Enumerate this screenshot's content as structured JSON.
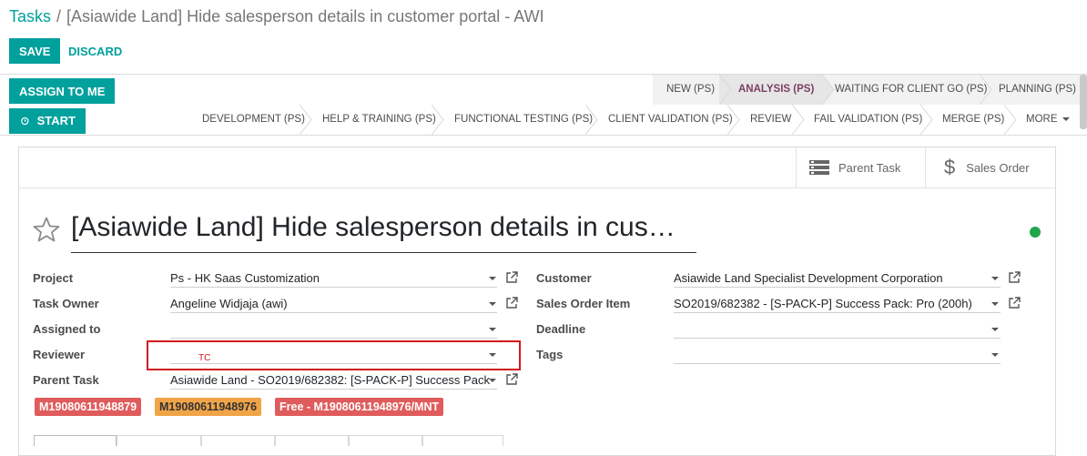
{
  "breadcrumb": {
    "root": "Tasks",
    "separator": "/",
    "current": "[Asiawide Land] Hide salesperson details in customer portal - AWI"
  },
  "controls": {
    "save": "SAVE",
    "discard": "DISCARD",
    "assign_to_me": "ASSIGN TO ME",
    "start": "START"
  },
  "stages": {
    "row1": [
      "NEW (PS)",
      "ANALYSIS (PS)",
      "WAITING FOR CLIENT GO (PS)",
      "PLANNING (PS)"
    ],
    "row2": [
      "DEVELOPMENT (PS)",
      "HELP & TRAINING (PS)",
      "FUNCTIONAL TESTING (PS)",
      "CLIENT VALIDATION (PS)",
      "REVIEW",
      "FAIL VALIDATION (PS)",
      "MERGE (PS)",
      "MORE"
    ],
    "active": "ANALYSIS (PS)"
  },
  "smart_buttons": {
    "parent_task": "Parent Task",
    "sales_order": "Sales Order"
  },
  "title": "[Asiawide Land] Hide salesperson details in cus…",
  "fields": {
    "project": {
      "label": "Project",
      "value": "Ps - HK Saas Customization"
    },
    "task_owner": {
      "label": "Task Owner",
      "value": "Angeline Widjaja (awi)"
    },
    "assigned_to": {
      "label": "Assigned to",
      "value": ""
    },
    "reviewer": {
      "label": "Reviewer",
      "value": ""
    },
    "parent_task": {
      "label": "Parent Task",
      "value": "Asiawide Land - SO2019/682382: [S-PACK-P] Success Pack"
    },
    "customer": {
      "label": "Customer",
      "value": "Asiawide Land Specialist Development Corporation"
    },
    "sales_order_item": {
      "label": "Sales Order Item",
      "value": "SO2019/682382 - [S-PACK-P] Success Pack: Pro (200h)"
    },
    "deadline": {
      "label": "Deadline",
      "value": ""
    },
    "tags": {
      "label": "Tags",
      "value": ""
    }
  },
  "annotation": "TC",
  "tags": [
    "M19080611948879",
    "M19080611948976",
    "Free - M19080611948976/MNT"
  ],
  "colors": {
    "primary": "#00a09d",
    "active_stage": "#7c3e66",
    "tag_red": "#e05c5c",
    "tag_orange": "#f0a448",
    "kanban_state": "#20a54b",
    "highlight": "#d11a1a"
  },
  "icons": {
    "star": "star-outline-icon",
    "clock": "clock-icon",
    "parent_task": "list-icon",
    "sales_order": "dollar-icon",
    "external": "external-link-icon"
  }
}
